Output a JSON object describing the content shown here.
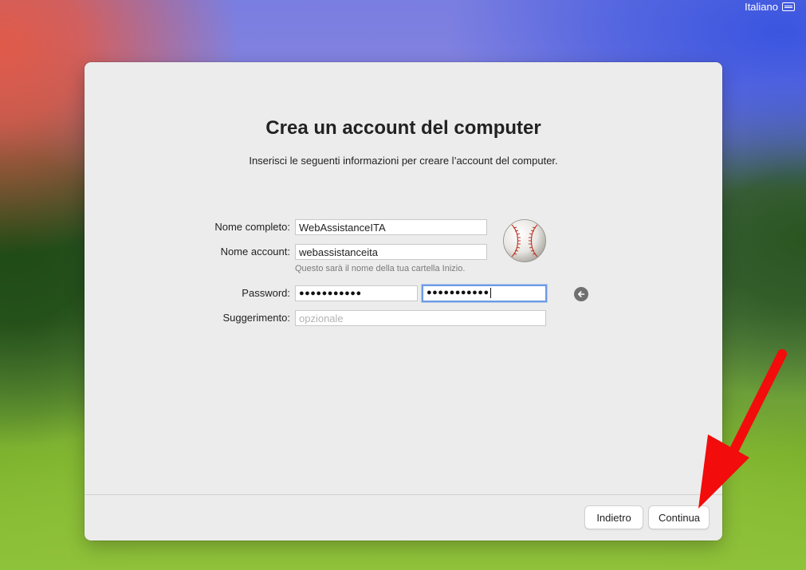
{
  "system": {
    "language": "Italiano",
    "language_icon": "keyboard-icon"
  },
  "window": {
    "title": "Crea un account del computer",
    "subtitle": "Inserisci le seguenti informazioni per creare l’account del computer."
  },
  "form": {
    "full_name_label": "Nome completo:",
    "full_name_value": "WebAssistanceITA",
    "account_name_label": "Nome account:",
    "account_name_value": "webassistanceita",
    "account_name_help": "Questo sarà il nome della tua cartella Inizio.",
    "password_label": "Password:",
    "password_masked": "●●●●●●●●●●●",
    "password_verify_masked": "●●●●●●●●●●●",
    "hint_label": "Suggerimento:",
    "hint_placeholder": "opzionale",
    "avatar_icon": "baseball-avatar-icon",
    "reveal_icon": "arrow-left-circle-icon"
  },
  "footer": {
    "back_label": "Indietro",
    "continue_label": "Continua"
  },
  "annotation": {
    "arrow_color": "#f20c0c"
  }
}
